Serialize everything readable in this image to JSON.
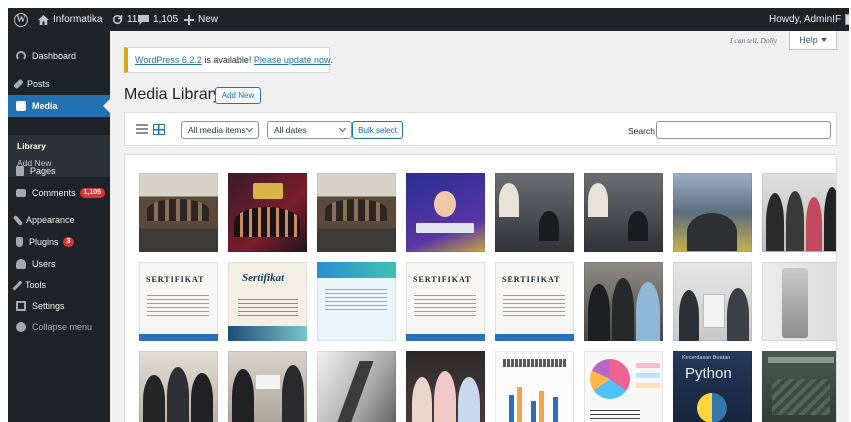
{
  "admin_bar": {
    "site_name": "Informatika",
    "updates_count": "11",
    "comments_count": "1,105",
    "new_label": "New",
    "howdy": "Howdy, AdminIF"
  },
  "sidebar": {
    "items": [
      {
        "label": "Dashboard",
        "icon": "dashboard-icon"
      },
      {
        "label": "Posts",
        "icon": "pin-icon"
      },
      {
        "label": "Media",
        "icon": "media-icon",
        "current": true
      },
      {
        "label": "Pages",
        "icon": "page-icon"
      },
      {
        "label": "Comments",
        "icon": "comment-icon",
        "badge": "1,105"
      },
      {
        "label": "Appearance",
        "icon": "brush-icon"
      },
      {
        "label": "Plugins",
        "icon": "plug-icon",
        "badge": "3"
      },
      {
        "label": "Users",
        "icon": "user-icon"
      },
      {
        "label": "Tools",
        "icon": "wrench-icon"
      },
      {
        "label": "Settings",
        "icon": "settings-icon"
      },
      {
        "label": "Collapse menu",
        "icon": "collapse-icon"
      }
    ],
    "submenu": {
      "library": "Library",
      "add_new": "Add New"
    }
  },
  "screen_meta": {
    "help": "Help",
    "dolly": "I can tell, Dolly"
  },
  "notice": {
    "link1": "WordPress 6.2.2",
    "middle": " is available! ",
    "link2": "Please update now",
    "end": "."
  },
  "page": {
    "title": "Media Library",
    "add_new": "Add New"
  },
  "toolbar": {
    "media_filter": "All media items",
    "date_filter": "All dates",
    "bulk_select": "Bulk select",
    "search_label": "Search",
    "search_value": ""
  },
  "thumbnail_texts": {
    "sertifikat": "SERTIFIKAT",
    "sertifikat_script": "Sertifikat",
    "python": "Python",
    "python_sub": "Kecerdasan Buatan"
  },
  "colors": {
    "admin_dark": "#1d2327",
    "accent": "#2271b1",
    "notice_border": "#dba617",
    "badge": "#d63638"
  }
}
